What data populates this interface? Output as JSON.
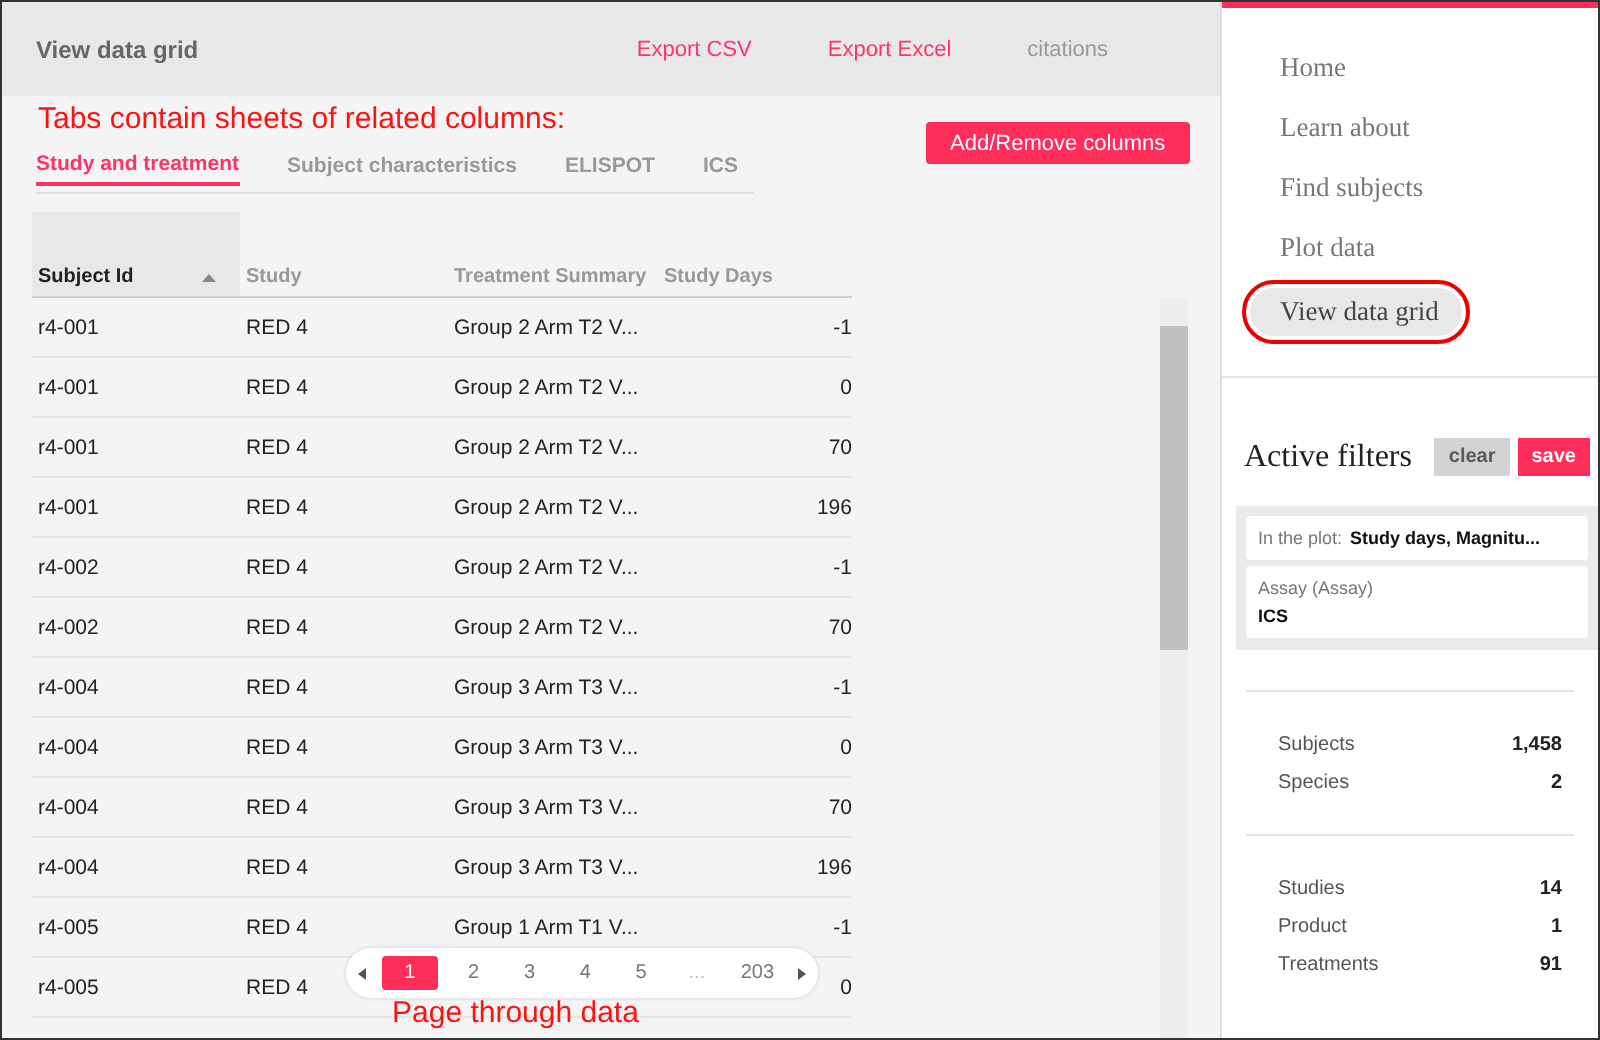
{
  "header": {
    "title": "View data grid",
    "links": [
      {
        "label": "Export CSV",
        "kind": "action"
      },
      {
        "label": "Export Excel",
        "kind": "action"
      },
      {
        "label": "citations",
        "kind": "muted"
      }
    ]
  },
  "annotations": {
    "tabs_note": "Tabs contain sheets of related columns:",
    "pager_note": "Page through data"
  },
  "tabs": [
    {
      "label": "Study and treatment",
      "selected": true
    },
    {
      "label": "Subject characteristics",
      "selected": false
    },
    {
      "label": "ELISPOT",
      "selected": false
    },
    {
      "label": "ICS",
      "selected": false
    }
  ],
  "add_remove_button": "Add/Remove columns",
  "table": {
    "columns": [
      {
        "label": "Subject Id",
        "sorted": true,
        "kind": "text"
      },
      {
        "label": "Study",
        "sorted": false,
        "kind": "text"
      },
      {
        "label": "Treatment Summary",
        "sorted": false,
        "kind": "text"
      },
      {
        "label": "Study Days",
        "sorted": false,
        "kind": "number"
      }
    ],
    "rows": [
      [
        "r4-001",
        "RED 4",
        "Group 2 Arm T2 V...",
        "-1"
      ],
      [
        "r4-001",
        "RED 4",
        "Group 2 Arm T2 V...",
        "0"
      ],
      [
        "r4-001",
        "RED 4",
        "Group 2 Arm T2 V...",
        "70"
      ],
      [
        "r4-001",
        "RED 4",
        "Group 2 Arm T2 V...",
        "196"
      ],
      [
        "r4-002",
        "RED 4",
        "Group 2 Arm T2 V...",
        "-1"
      ],
      [
        "r4-002",
        "RED 4",
        "Group 2 Arm T2 V...",
        "70"
      ],
      [
        "r4-004",
        "RED 4",
        "Group 3 Arm T3 V...",
        "-1"
      ],
      [
        "r4-004",
        "RED 4",
        "Group 3 Arm T3 V...",
        "0"
      ],
      [
        "r4-004",
        "RED 4",
        "Group 3 Arm T3 V...",
        "70"
      ],
      [
        "r4-004",
        "RED 4",
        "Group 3 Arm T3 V...",
        "196"
      ],
      [
        "r4-005",
        "RED 4",
        "Group 1 Arm T1 V...",
        "-1"
      ],
      [
        "r4-005",
        "RED 4",
        "",
        "0"
      ]
    ]
  },
  "pagination": {
    "pages": [
      {
        "label": "1",
        "kind": "page",
        "selected": true
      },
      {
        "label": "2",
        "kind": "page",
        "selected": false
      },
      {
        "label": "3",
        "kind": "page",
        "selected": false
      },
      {
        "label": "4",
        "kind": "page",
        "selected": false
      },
      {
        "label": "5",
        "kind": "page",
        "selected": false
      },
      {
        "label": "...",
        "kind": "gap",
        "selected": false
      },
      {
        "label": "203",
        "kind": "page",
        "selected": false
      }
    ]
  },
  "sidebar": {
    "items": [
      {
        "label": "Home",
        "selected": false,
        "circled": false
      },
      {
        "label": "Learn about",
        "selected": false,
        "circled": false
      },
      {
        "label": "Find subjects",
        "selected": false,
        "circled": false
      },
      {
        "label": "Plot data",
        "selected": false,
        "circled": false
      },
      {
        "label": "View data grid",
        "selected": true,
        "circled": true
      }
    ],
    "filters": {
      "title": "Active filters",
      "buttons": [
        {
          "label": "clear",
          "kind": "secondary"
        },
        {
          "label": "save",
          "kind": "primary"
        }
      ],
      "cards": [
        {
          "kind": "inline",
          "label": "In the plot:",
          "value": "Study days, Magnitu..."
        },
        {
          "kind": "stacked",
          "label": "Assay (Assay)",
          "value": "ICS"
        }
      ]
    },
    "stat_groups": [
      [
        {
          "label": "Subjects",
          "value": "1,458"
        },
        {
          "label": "Species",
          "value": "2"
        }
      ],
      [
        {
          "label": "Studies",
          "value": "14"
        },
        {
          "label": "Product",
          "value": "1"
        },
        {
          "label": "Treatments",
          "value": "91"
        }
      ]
    ]
  }
}
